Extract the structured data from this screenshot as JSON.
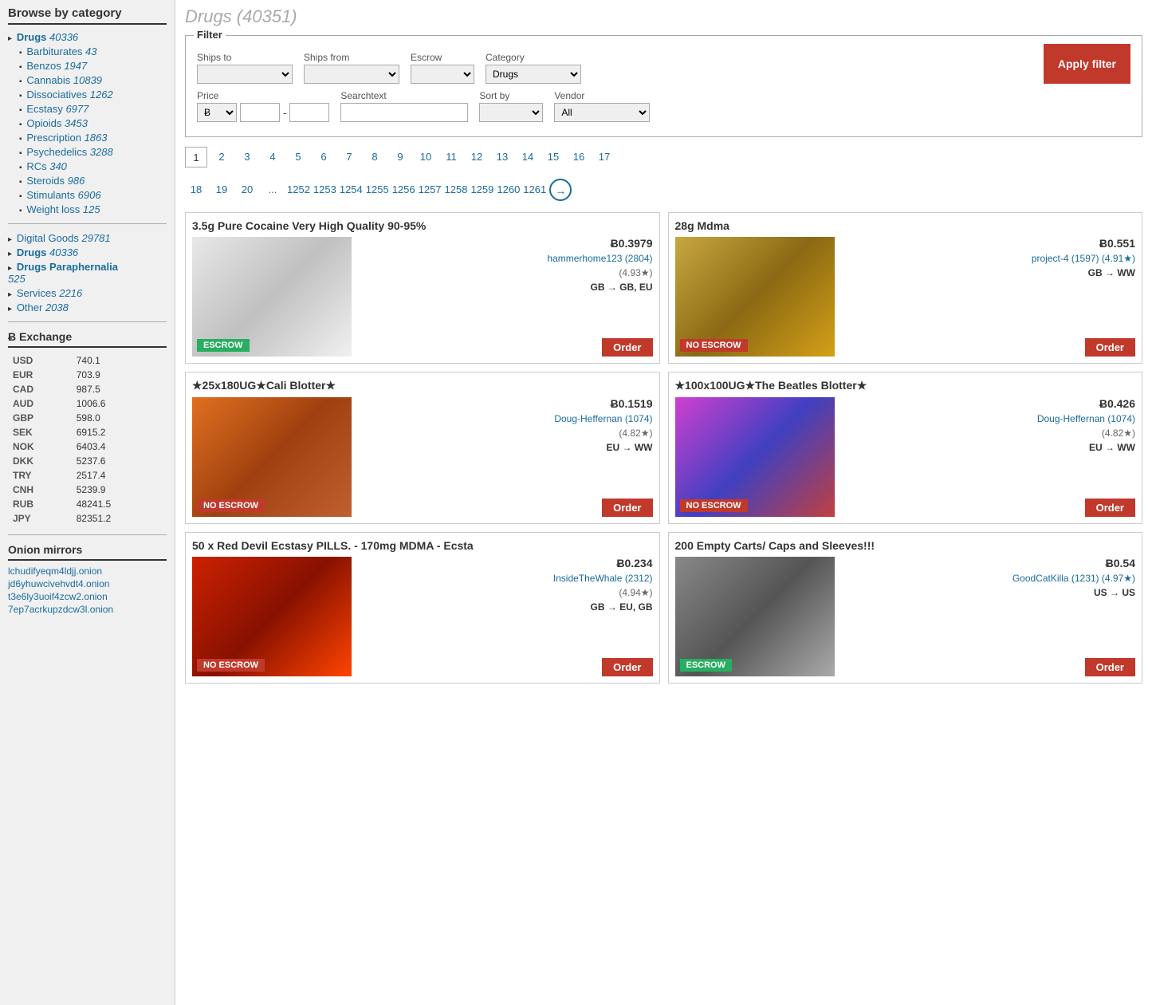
{
  "sidebar": {
    "section_title": "Browse by category",
    "categories": [
      {
        "label": "Drugs",
        "count": "40336",
        "active": true,
        "indent": 0
      },
      {
        "label": "Barbiturates",
        "count": "43",
        "active": false,
        "indent": 1
      },
      {
        "label": "Benzos",
        "count": "1947",
        "active": false,
        "indent": 1
      },
      {
        "label": "Cannabis",
        "count": "10839",
        "active": false,
        "indent": 1
      },
      {
        "label": "Dissociatives",
        "count": "1262",
        "active": false,
        "indent": 1
      },
      {
        "label": "Ecstasy",
        "count": "6977",
        "active": false,
        "indent": 1
      },
      {
        "label": "Opioids",
        "count": "3453",
        "active": false,
        "indent": 1
      },
      {
        "label": "Prescription",
        "count": "1863",
        "active": false,
        "indent": 1
      },
      {
        "label": "Psychedelics",
        "count": "3288",
        "active": false,
        "indent": 1
      },
      {
        "label": "RCs",
        "count": "340",
        "active": false,
        "indent": 1
      },
      {
        "label": "Steroids",
        "count": "986",
        "active": false,
        "indent": 1
      },
      {
        "label": "Stimulants",
        "count": "6906",
        "active": false,
        "indent": 1
      },
      {
        "label": "Weight loss",
        "count": "125",
        "active": false,
        "indent": 1
      }
    ],
    "top_categories": [
      {
        "label": "Digital Goods",
        "count": "29781"
      },
      {
        "label": "Drugs",
        "count": "40336"
      },
      {
        "label": "Drugs Paraphernalia",
        "count": "525"
      },
      {
        "label": "Services",
        "count": "2216"
      },
      {
        "label": "Other",
        "count": "2038"
      }
    ],
    "exchange_title": "Ƀ Exchange",
    "exchange_rates": [
      {
        "currency": "USD",
        "rate": "740.1"
      },
      {
        "currency": "EUR",
        "rate": "703.9"
      },
      {
        "currency": "CAD",
        "rate": "987.5"
      },
      {
        "currency": "AUD",
        "rate": "1006.6"
      },
      {
        "currency": "GBP",
        "rate": "598.0"
      },
      {
        "currency": "SEK",
        "rate": "6915.2"
      },
      {
        "currency": "NOK",
        "rate": "6403.4"
      },
      {
        "currency": "DKK",
        "rate": "5237.6"
      },
      {
        "currency": "TRY",
        "rate": "2517.4"
      },
      {
        "currency": "CNH",
        "rate": "5239.9"
      },
      {
        "currency": "RUB",
        "rate": "48241.5"
      },
      {
        "currency": "JPY",
        "rate": "82351.2"
      }
    ],
    "onion_title": "Onion mirrors",
    "onion_links": [
      "lchudifyeqm4ldjj.onion",
      "jd6yhuwcivehvdt4.onion",
      "t3e6ly3uoif4zcw2.onion",
      "7ep7acrkupzdcw3l.onion"
    ]
  },
  "main": {
    "page_title": "Drugs (40351)",
    "filter": {
      "legend": "Filter",
      "ships_to_label": "Ships to",
      "ships_from_label": "Ships from",
      "escrow_label": "Escrow",
      "category_label": "Category",
      "category_value": "Drugs",
      "price_label": "Price",
      "price_symbol": "Ƀ",
      "searchtext_label": "Searchtext",
      "sort_by_label": "Sort by",
      "vendor_label": "Vendor",
      "vendor_value": "All",
      "apply_label": "Apply filter"
    },
    "pagination": {
      "row1": [
        "1",
        "2",
        "3",
        "4",
        "5",
        "6",
        "7",
        "8",
        "9",
        "10",
        "11",
        "12",
        "13",
        "14",
        "15",
        "16",
        "17"
      ],
      "row2": [
        "18",
        "19",
        "20",
        "...",
        "1252",
        "1253",
        "1254",
        "1255",
        "1256",
        "1257",
        "1258",
        "1259",
        "1260",
        "1261"
      ]
    },
    "products": [
      {
        "id": "p1",
        "title": "3.5g Pure Cocaine Very High Quality 90-95%",
        "price": "Ƀ0.3979",
        "vendor": "hammerhome123 (2804)",
        "rating": "(4.93★)",
        "shipping": "GB → GB, EU",
        "escrow": "ESCROW",
        "escrow_type": "green",
        "img_class": "img-cocaine",
        "order_label": "Order"
      },
      {
        "id": "p2",
        "title": "28g Mdma",
        "price": "Ƀ0.551",
        "vendor": "project-4 (1597) (4.91★)",
        "rating": "",
        "shipping": "GB → WW",
        "escrow": "NO ESCROW",
        "escrow_type": "red",
        "img_class": "img-mdma",
        "order_label": "Order"
      },
      {
        "id": "p3",
        "title": "★25x180UG★Cali Blotter★",
        "price": "Ƀ0.1519",
        "vendor": "Doug-Heffernan (1074)",
        "rating": "(4.82★)",
        "shipping": "EU → WW",
        "escrow": "NO ESCROW",
        "escrow_type": "red",
        "img_class": "img-blotter",
        "order_label": "Order"
      },
      {
        "id": "p4",
        "title": "★100x100UG★The Beatles Blotter★",
        "price": "Ƀ0.426",
        "vendor": "Doug-Heffernan (1074)",
        "rating": "(4.82★)",
        "shipping": "EU → WW",
        "escrow": "NO ESCROW",
        "escrow_type": "red",
        "img_class": "img-beatles",
        "order_label": "Order"
      },
      {
        "id": "p5",
        "title": "50 x Red Devil Ecstasy PILLS. - 170mg MDMA - Ecsta",
        "price": "Ƀ0.234",
        "vendor": "InsideTheWhale (2312)",
        "rating": "(4.94★)",
        "shipping": "GB → EU, GB",
        "escrow": "NO ESCROW",
        "escrow_type": "red",
        "img_class": "img-ecstasy",
        "order_label": "Order"
      },
      {
        "id": "p6",
        "title": "200 Empty Carts/ Caps and Sleeves!!!",
        "price": "Ƀ0.54",
        "vendor": "GoodCatKilla (1231) (4.97★)",
        "rating": "",
        "shipping": "US → US",
        "escrow": "ESCROW",
        "escrow_type": "green",
        "img_class": "img-carts",
        "order_label": "Order"
      }
    ]
  }
}
